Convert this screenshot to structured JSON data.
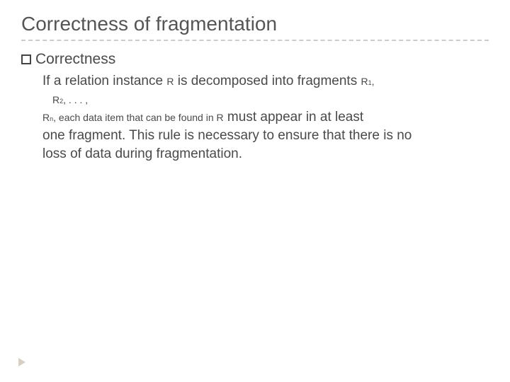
{
  "slide": {
    "title": "Correctness of fragmentation",
    "bullet_label": "Correctness",
    "line1_a": "If a relation instance ",
    "line1_b": "R",
    "line1_c": " is decomposed into fragments ",
    "line1_d": "R",
    "line1_e": "1",
    "line1_f": ",",
    "line2_a": "R",
    "line2_b": "2",
    "line2_c": ", . . . ,",
    "line3_a": "R",
    "line3_b": "n",
    "line3_c": ", each data item that can be found in ",
    "line3_d": "R",
    "line3_e": " must appear in at least",
    "line4": "one fragment. This rule is necessary to ensure that there is no",
    "line5": "loss of data during fragmentation."
  }
}
